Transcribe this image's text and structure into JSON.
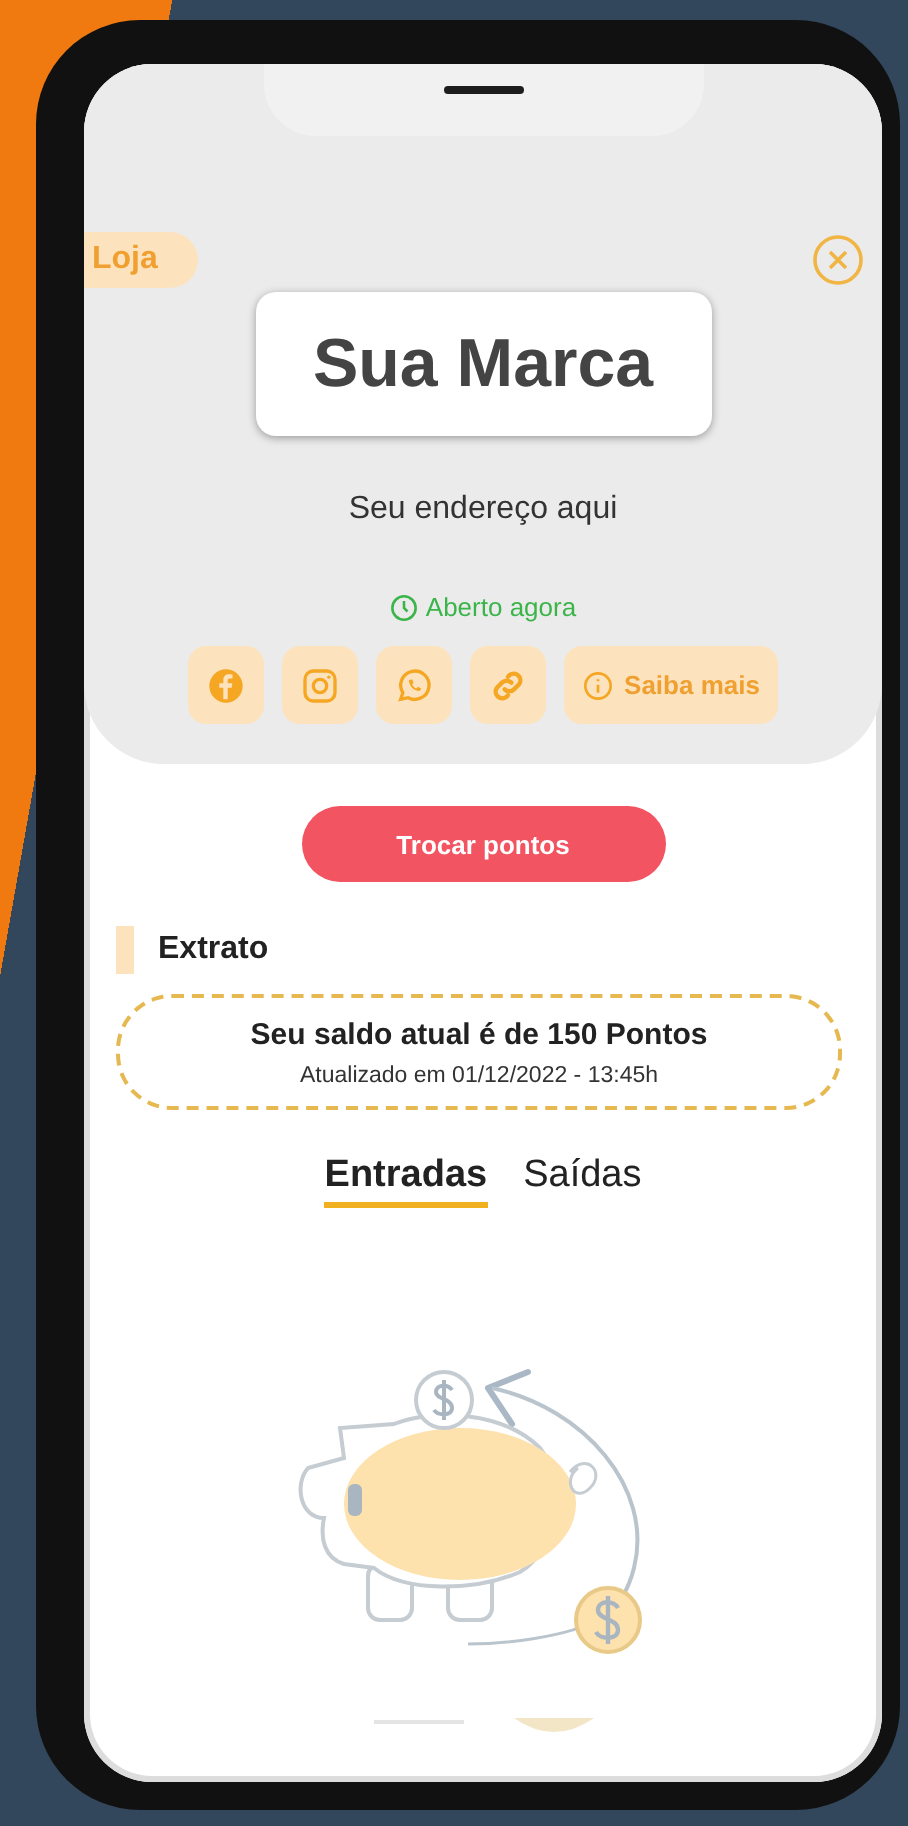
{
  "store_tag": {
    "label": "Loja"
  },
  "brand": {
    "name": "Sua Marca"
  },
  "address": "Seu endereço aqui",
  "status": {
    "label": "Aberto agora",
    "open": true
  },
  "links": [
    {
      "kind": "facebook"
    },
    {
      "kind": "instagram"
    },
    {
      "kind": "whatsapp"
    },
    {
      "kind": "link"
    },
    {
      "kind": "info",
      "label": "Saiba mais"
    }
  ],
  "primary_button": {
    "label": "Trocar pontos"
  },
  "statement": {
    "title": "Extrato",
    "balance": "Seu saldo atual é de 150 Pontos",
    "updated": "Atualizado em 01/12/2022 - 13:45h"
  },
  "tabs": [
    {
      "label": "Entradas",
      "selected": true
    },
    {
      "label": "Saídas",
      "selected": false
    }
  ]
}
